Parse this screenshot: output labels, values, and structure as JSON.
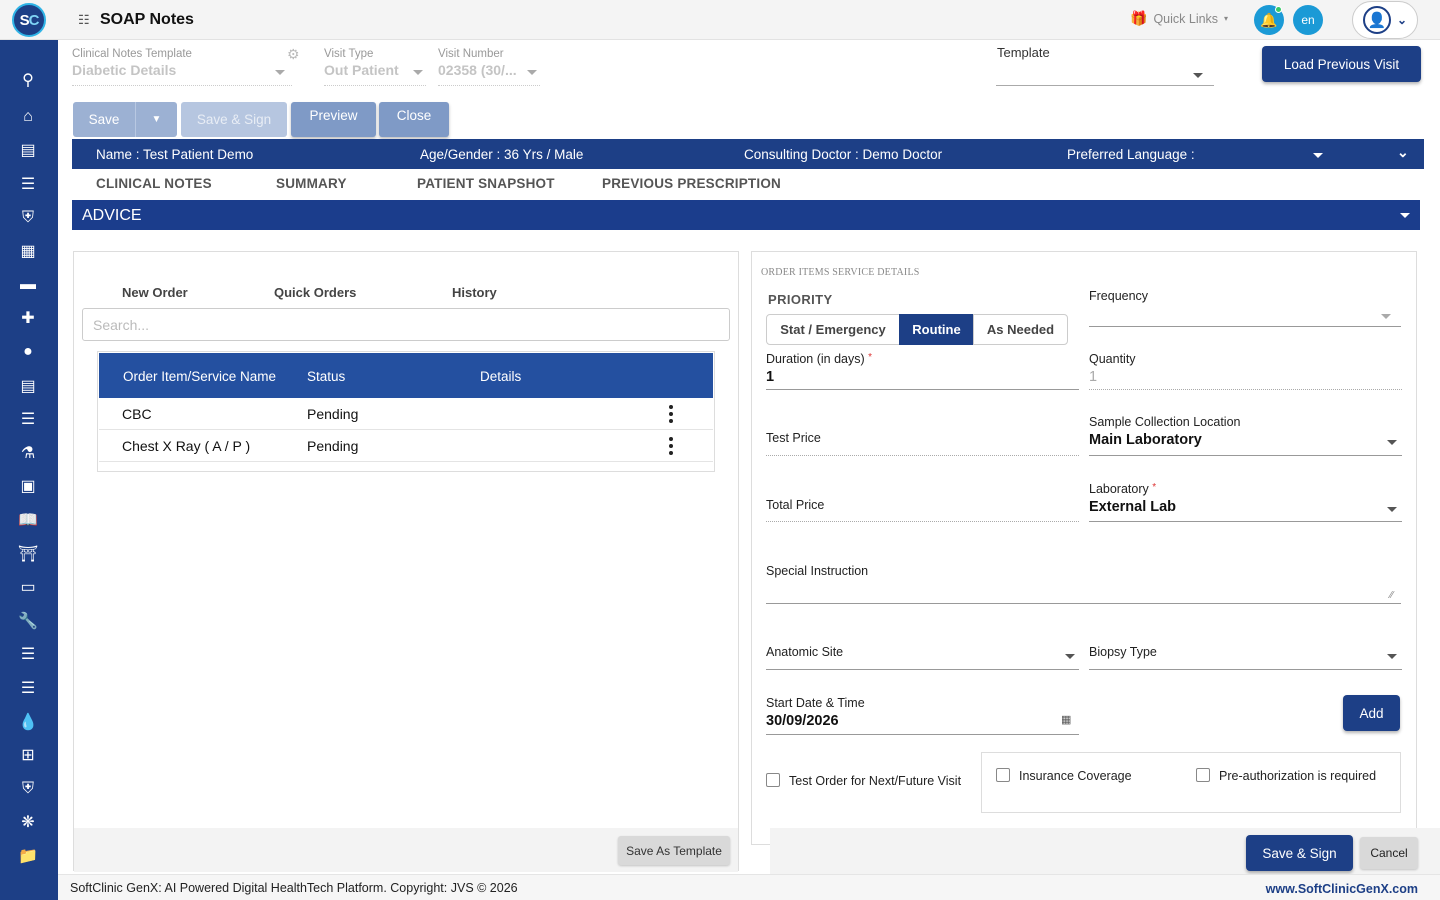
{
  "header": {
    "logo_text_s": "S",
    "logo_text_c": "C",
    "title": "SOAP Notes",
    "quick_links": "Quick Links",
    "lang": "en"
  },
  "form": {
    "clinical_notes_template_label": "Clinical Notes Template",
    "clinical_notes_template_value": "Diabetic Details",
    "visit_type_label": "Visit Type",
    "visit_type_value": "Out Patient",
    "visit_number_label": "Visit Number",
    "visit_number_value": "02358 (30/...",
    "template_label": "Template",
    "load_previous_visit": "Load Previous Visit"
  },
  "toolbar": {
    "save": "Save",
    "save_sign": "Save & Sign",
    "preview": "Preview",
    "close": "Close"
  },
  "patient": {
    "name": "Name :  Test Patient Demo",
    "age_gender": "Age/Gender :  36 Yrs / Male",
    "doctor": "Consulting Doctor :  Demo Doctor",
    "language": "Preferred Language :"
  },
  "tabs": [
    "CLINICAL NOTES",
    "SUMMARY",
    "PATIENT SNAPSHOT",
    "PREVIOUS PRESCRIPTION"
  ],
  "advice": {
    "title": "ADVICE"
  },
  "left": {
    "subtabs": [
      "New Order",
      "Quick Orders",
      "History"
    ],
    "search_placeholder": "Search...",
    "columns": [
      "Order Item/Service Name",
      "Status",
      "Details"
    ],
    "rows": [
      {
        "name": "CBC",
        "status": "Pending"
      },
      {
        "name": "Chest X Ray ( A / P )",
        "status": "Pending"
      }
    ],
    "save_as_template": "Save As Template"
  },
  "right": {
    "section_label": "ORDER ITEMS SERVICE DETAILS",
    "priority_label": "PRIORITY",
    "priority_options": [
      "Stat / Emergency",
      "Routine",
      "As Needed"
    ],
    "priority_selected": "Routine",
    "frequency_label": "Frequency",
    "duration_label": "Duration (in days)",
    "duration_value": "1",
    "quantity_label": "Quantity",
    "quantity_value": "1",
    "test_price_label": "Test Price",
    "sample_location_label": "Sample Collection Location",
    "sample_location_value": "Main Laboratory",
    "total_price_label": "Total Price",
    "laboratory_label": "Laboratory",
    "laboratory_value": "External Lab",
    "special_instruction_label": "Special Instruction",
    "anatomic_site_label": "Anatomic Site",
    "biopsy_type_label": "Biopsy Type",
    "start_datetime_label": "Start Date & Time",
    "start_datetime_value": "30/09/2026",
    "add": "Add",
    "future_visit_label": "Test Order for Next/Future Visit",
    "insurance_label": "Insurance Coverage",
    "preauth_label": "Pre-authorization is required",
    "save_sign": "Save & Sign",
    "cancel": "Cancel"
  },
  "footer": {
    "copyright": "SoftClinic GenX: AI Powered Digital HealthTech Platform. Copyright: JVS © 2026",
    "website": "www.SoftClinicGenX.com"
  },
  "colors": {
    "primary": "#1d3f86",
    "accent": "#1b9ad6"
  }
}
